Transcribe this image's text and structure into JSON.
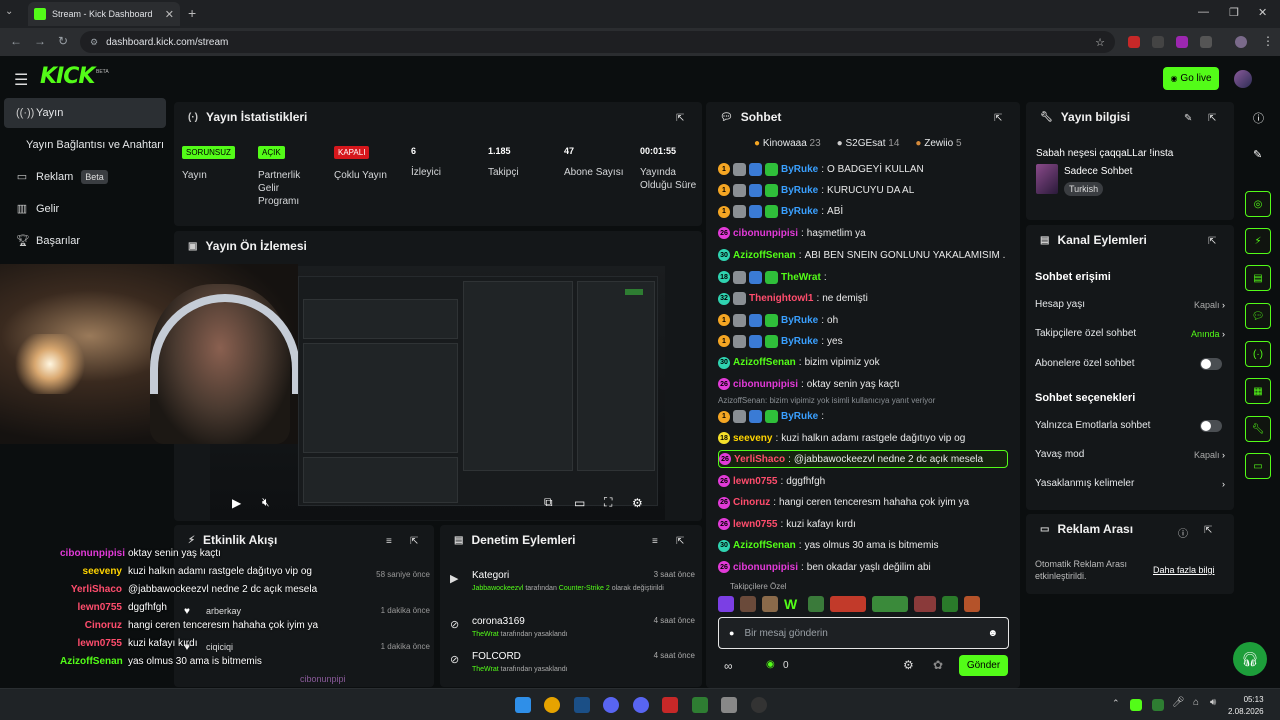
{
  "browser": {
    "tab_title": "Stream - Kick Dashboard",
    "url": "dashboard.kick.com/stream"
  },
  "header": {
    "logo": "KICK",
    "beta": "BETA",
    "go_live": "Go live"
  },
  "sidebar": {
    "items": [
      {
        "label": "Yayın"
      },
      {
        "label": "Yayın Bağlantısı ve Anahtarı"
      },
      {
        "label": "Reklam",
        "badge": "Beta"
      },
      {
        "label": "Gelir"
      },
      {
        "label": "Başarılar"
      }
    ]
  },
  "stats": {
    "title": "Yayın İstatistikleri",
    "items": [
      {
        "value": "SORUNSUZ",
        "label": "Yayın"
      },
      {
        "value": "AÇIK",
        "label": "Partnerlik Gelir Programı"
      },
      {
        "value": "KAPALI",
        "label": "Çoklu Yayın"
      },
      {
        "value": "6",
        "label": "İzleyici"
      },
      {
        "value": "1.185",
        "label": "Takipçi"
      },
      {
        "value": "47",
        "label": "Abone Sayısı"
      },
      {
        "value": "00:01:55",
        "label": "Yayında Olduğu Süre"
      }
    ]
  },
  "preview": {
    "title": "Yayın Ön İzlemesi"
  },
  "activity": {
    "title": "Etkinlik Akışı",
    "rows": [
      {
        "name": "",
        "time": "58 saniye önce"
      },
      {
        "name": "arberkay",
        "time": "1 dakika önce"
      },
      {
        "name": "ciqiciqi",
        "time": "1 dakika önce"
      }
    ],
    "bottom_name": "cibonunpipi"
  },
  "moderation": {
    "title": "Denetim Eylemleri",
    "items": [
      {
        "title": "Kategori",
        "time": "3 saat önce",
        "actor": "Jabbawockeezvl",
        "line1": " tarafından ",
        "target": "Counter-Strike 2",
        "line2": " olarak değiştirildi"
      },
      {
        "title": "corona3169",
        "time": "4 saat önce",
        "actor": "TheWrat",
        "line1": " tarafından yasaklandı"
      },
      {
        "title": "FOLCORD",
        "time": "4 saat önce",
        "actor": "TheWrat",
        "line1": " tarafından yasaklandı"
      }
    ]
  },
  "overlay_chat": [
    {
      "name": "cibonunpipisi",
      "msg": "oktay senin yaş kaçtı",
      "color": "#e23ad8"
    },
    {
      "name": "seeveny",
      "msg": "kuzi halkın adamı rastgele dağıtıyo vip og",
      "color": "#ffd400"
    },
    {
      "name": "YerliShaco",
      "msg": "@jabbawockeezvl nedne 2 dc açık mesela",
      "color": "#ff4d6d"
    },
    {
      "name": "lewn0755",
      "msg": "dggfhfgh",
      "color": "#ff4d6d"
    },
    {
      "name": "Cinoruz",
      "msg": "hangi ceren tenceresm hahaha çok iyim ya",
      "color": "#ff4d6d"
    },
    {
      "name": "lewn0755",
      "msg": "kuzi kafayı kırdı",
      "color": "#ff4d6d"
    },
    {
      "name": "AzizoffSenan",
      "msg": "yas olmus 30 ama is bitmemis",
      "color": "#53fc18"
    }
  ],
  "chat": {
    "title": "Sohbet",
    "top_gifters": [
      {
        "name": "Kinowaaa",
        "count": "23"
      },
      {
        "name": "S2GEsat",
        "count": "14"
      },
      {
        "name": "Zewiio",
        "count": "5"
      }
    ],
    "messages": [
      {
        "lvl": "1",
        "lvlColor": "#f5a623",
        "name": "ByRuke",
        "color": "#3aa0ff",
        "text": "O BADGEYİ KULLAN",
        "badges": 3
      },
      {
        "lvl": "1",
        "lvlColor": "#f5a623",
        "name": "ByRuke",
        "color": "#3aa0ff",
        "text": "KURUCUYU DA AL",
        "badges": 3
      },
      {
        "lvl": "1",
        "lvlColor": "#f5a623",
        "name": "ByRuke",
        "color": "#3aa0ff",
        "text": "ABİ",
        "badges": 3
      },
      {
        "lvl": "26",
        "lvlColor": "#e23ad8",
        "name": "cibonunpipisi",
        "color": "#e23ad8",
        "text": "haşmetlim ya",
        "badges": 0
      },
      {
        "lvl": "30",
        "lvlColor": "#2fd3b0",
        "name": "AzizoffSenan",
        "color": "#53fc18",
        "text": "ABI BEN SNEIN GONLUNU YAKALAMISIM .",
        "badges": 0
      },
      {
        "lvl": "18",
        "lvlColor": "#2fd3b0",
        "name": "TheWrat",
        "color": "#53fc18",
        "text": "",
        "badges": 3
      },
      {
        "lvl": "32",
        "lvlColor": "#2fd3b0",
        "name": "Thenightowl1",
        "color": "#ff4d6d",
        "text": "ne demişti",
        "badges": 1
      },
      {
        "lvl": "1",
        "lvlColor": "#f5a623",
        "name": "ByRuke",
        "color": "#3aa0ff",
        "text": "oh",
        "badges": 3
      },
      {
        "lvl": "1",
        "lvlColor": "#f5a623",
        "name": "ByRuke",
        "color": "#3aa0ff",
        "text": "yes",
        "badges": 3
      },
      {
        "lvl": "30",
        "lvlColor": "#2fd3b0",
        "name": "AzizoffSenan",
        "color": "#53fc18",
        "text": "bizim vipimiz yok",
        "badges": 0
      },
      {
        "lvl": "26",
        "lvlColor": "#e23ad8",
        "name": "cibonunpipisi",
        "color": "#e23ad8",
        "text": "oktay senin yaş kaçtı",
        "badges": 0
      },
      {
        "lvl": "1",
        "lvlColor": "#f5a623",
        "name": "ByRuke",
        "color": "#3aa0ff",
        "text": "",
        "badges": 3,
        "reply": "AzizoffSenan: bizim vipimiz yok isimli kullanıcıya yanıt veriyor"
      },
      {
        "lvl": "18",
        "lvlColor": "#f5e02a",
        "name": "seeveny",
        "color": "#ffd400",
        "text": "kuzi halkın adamı rastgele dağıtıyo vip og",
        "badges": 0
      },
      {
        "lvl": "26",
        "lvlColor": "#e23ad8",
        "name": "YerliShaco",
        "color": "#ff4d6d",
        "text": "@jabbawockeezvl nedne 2 dc açık mesela",
        "badges": 0,
        "highlight": true
      },
      {
        "lvl": "26",
        "lvlColor": "#e23ad8",
        "name": "lewn0755",
        "color": "#ff4d6d",
        "text": "dggfhfgh",
        "badges": 0
      },
      {
        "lvl": "26",
        "lvlColor": "#e23ad8",
        "name": "Cinoruz",
        "color": "#ff4d6d",
        "text": "hangi ceren tenceresm hahaha çok iyim ya",
        "badges": 0
      },
      {
        "lvl": "26",
        "lvlColor": "#e23ad8",
        "name": "lewn0755",
        "color": "#ff4d6d",
        "text": "kuzi kafayı kırdı",
        "badges": 0
      },
      {
        "lvl": "30",
        "lvlColor": "#2fd3b0",
        "name": "AzizoffSenan",
        "color": "#53fc18",
        "text": "yas olmus 30 ama is bitmemis",
        "badges": 0
      },
      {
        "lvl": "26",
        "lvlColor": "#e23ad8",
        "name": "cibonunpipisi",
        "color": "#e23ad8",
        "text": "ben okadar yaşlı değilim abi",
        "badges": 0
      }
    ],
    "followers_only": "Takipçilere Özel",
    "input_placeholder": "Bir mesaj gönderin",
    "points": "0",
    "send": "Gönder"
  },
  "stream_info": {
    "title": "Yayın bilgisi",
    "stream_title": "Sabah neşesi çaqqaLLar !insta",
    "category": "Sadece Sohbet",
    "tag": "Turkish"
  },
  "channel_actions": {
    "title": "Kanal Eylemleri",
    "section1": "Sohbet erişimi",
    "rows1": [
      {
        "label": "Hesap yaşı",
        "value": "Kapalı",
        "green": false
      },
      {
        "label": "Takipçilere özel sohbet",
        "value": "Anında",
        "green": true
      },
      {
        "label": "Abonelere özel sohbet",
        "value": "",
        "toggle": true
      }
    ],
    "section2": "Sohbet seçenekleri",
    "rows2": [
      {
        "label": "Yalnızca Emotlarla sohbet",
        "value": "",
        "toggle": true
      },
      {
        "label": "Yavaş mod",
        "value": "Kapalı",
        "green": false
      },
      {
        "label": "Yasaklanmış kelimeler",
        "value": "",
        "green": false
      }
    ]
  },
  "ad_break": {
    "title": "Reklam Arası",
    "text": "Otomatik Reklam Arası etkinleştirildi.",
    "link": "Daha fazla bilgi"
  },
  "taskbar": {
    "time": "05:13",
    "date": "2.08.2026"
  },
  "colors": {
    "accent": "#53fc18",
    "danger": "#d6171c"
  }
}
